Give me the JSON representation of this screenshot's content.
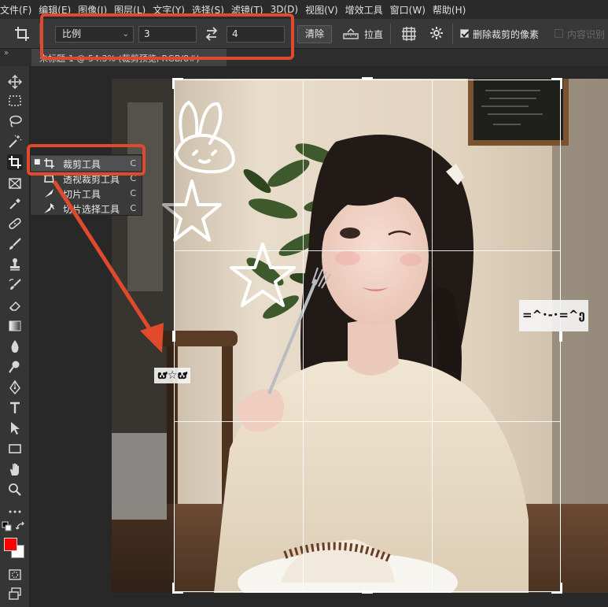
{
  "menu": {
    "items": [
      "文件(F)",
      "编辑(E)",
      "图像(I)",
      "图层(L)",
      "文字(Y)",
      "选择(S)",
      "滤镜(T)",
      "3D(D)",
      "视图(V)",
      "增效工具",
      "窗口(W)",
      "帮助(H)"
    ]
  },
  "options_bar": {
    "ratio_mode": "比例",
    "ratio_width": "3",
    "ratio_height": "4",
    "clear_label": "清除",
    "straighten_label": "拉直",
    "delete_cropped_label": "删除裁剪的像素",
    "delete_cropped_checked": true,
    "content_aware_label": "内容识别",
    "content_aware_checked": false
  },
  "document_tab": {
    "title": "未标题-1 @ 54.3% (裁剪预览, RGB/8#)"
  },
  "flyout": {
    "items": [
      {
        "label": "裁剪工具",
        "shortcut": "C",
        "selected": true
      },
      {
        "label": "透视裁剪工具",
        "shortcut": "C",
        "selected": false
      },
      {
        "label": "切片工具",
        "shortcut": "C",
        "selected": false
      },
      {
        "label": "切片选择工具",
        "shortcut": "C",
        "selected": false
      }
    ]
  },
  "stickers": {
    "left": "ຜ☆ຜ",
    "right": "=^･-･=^ე"
  },
  "colors": {
    "foreground": "#ff0000",
    "background": "#ffffff",
    "highlight": "#e0492c"
  }
}
